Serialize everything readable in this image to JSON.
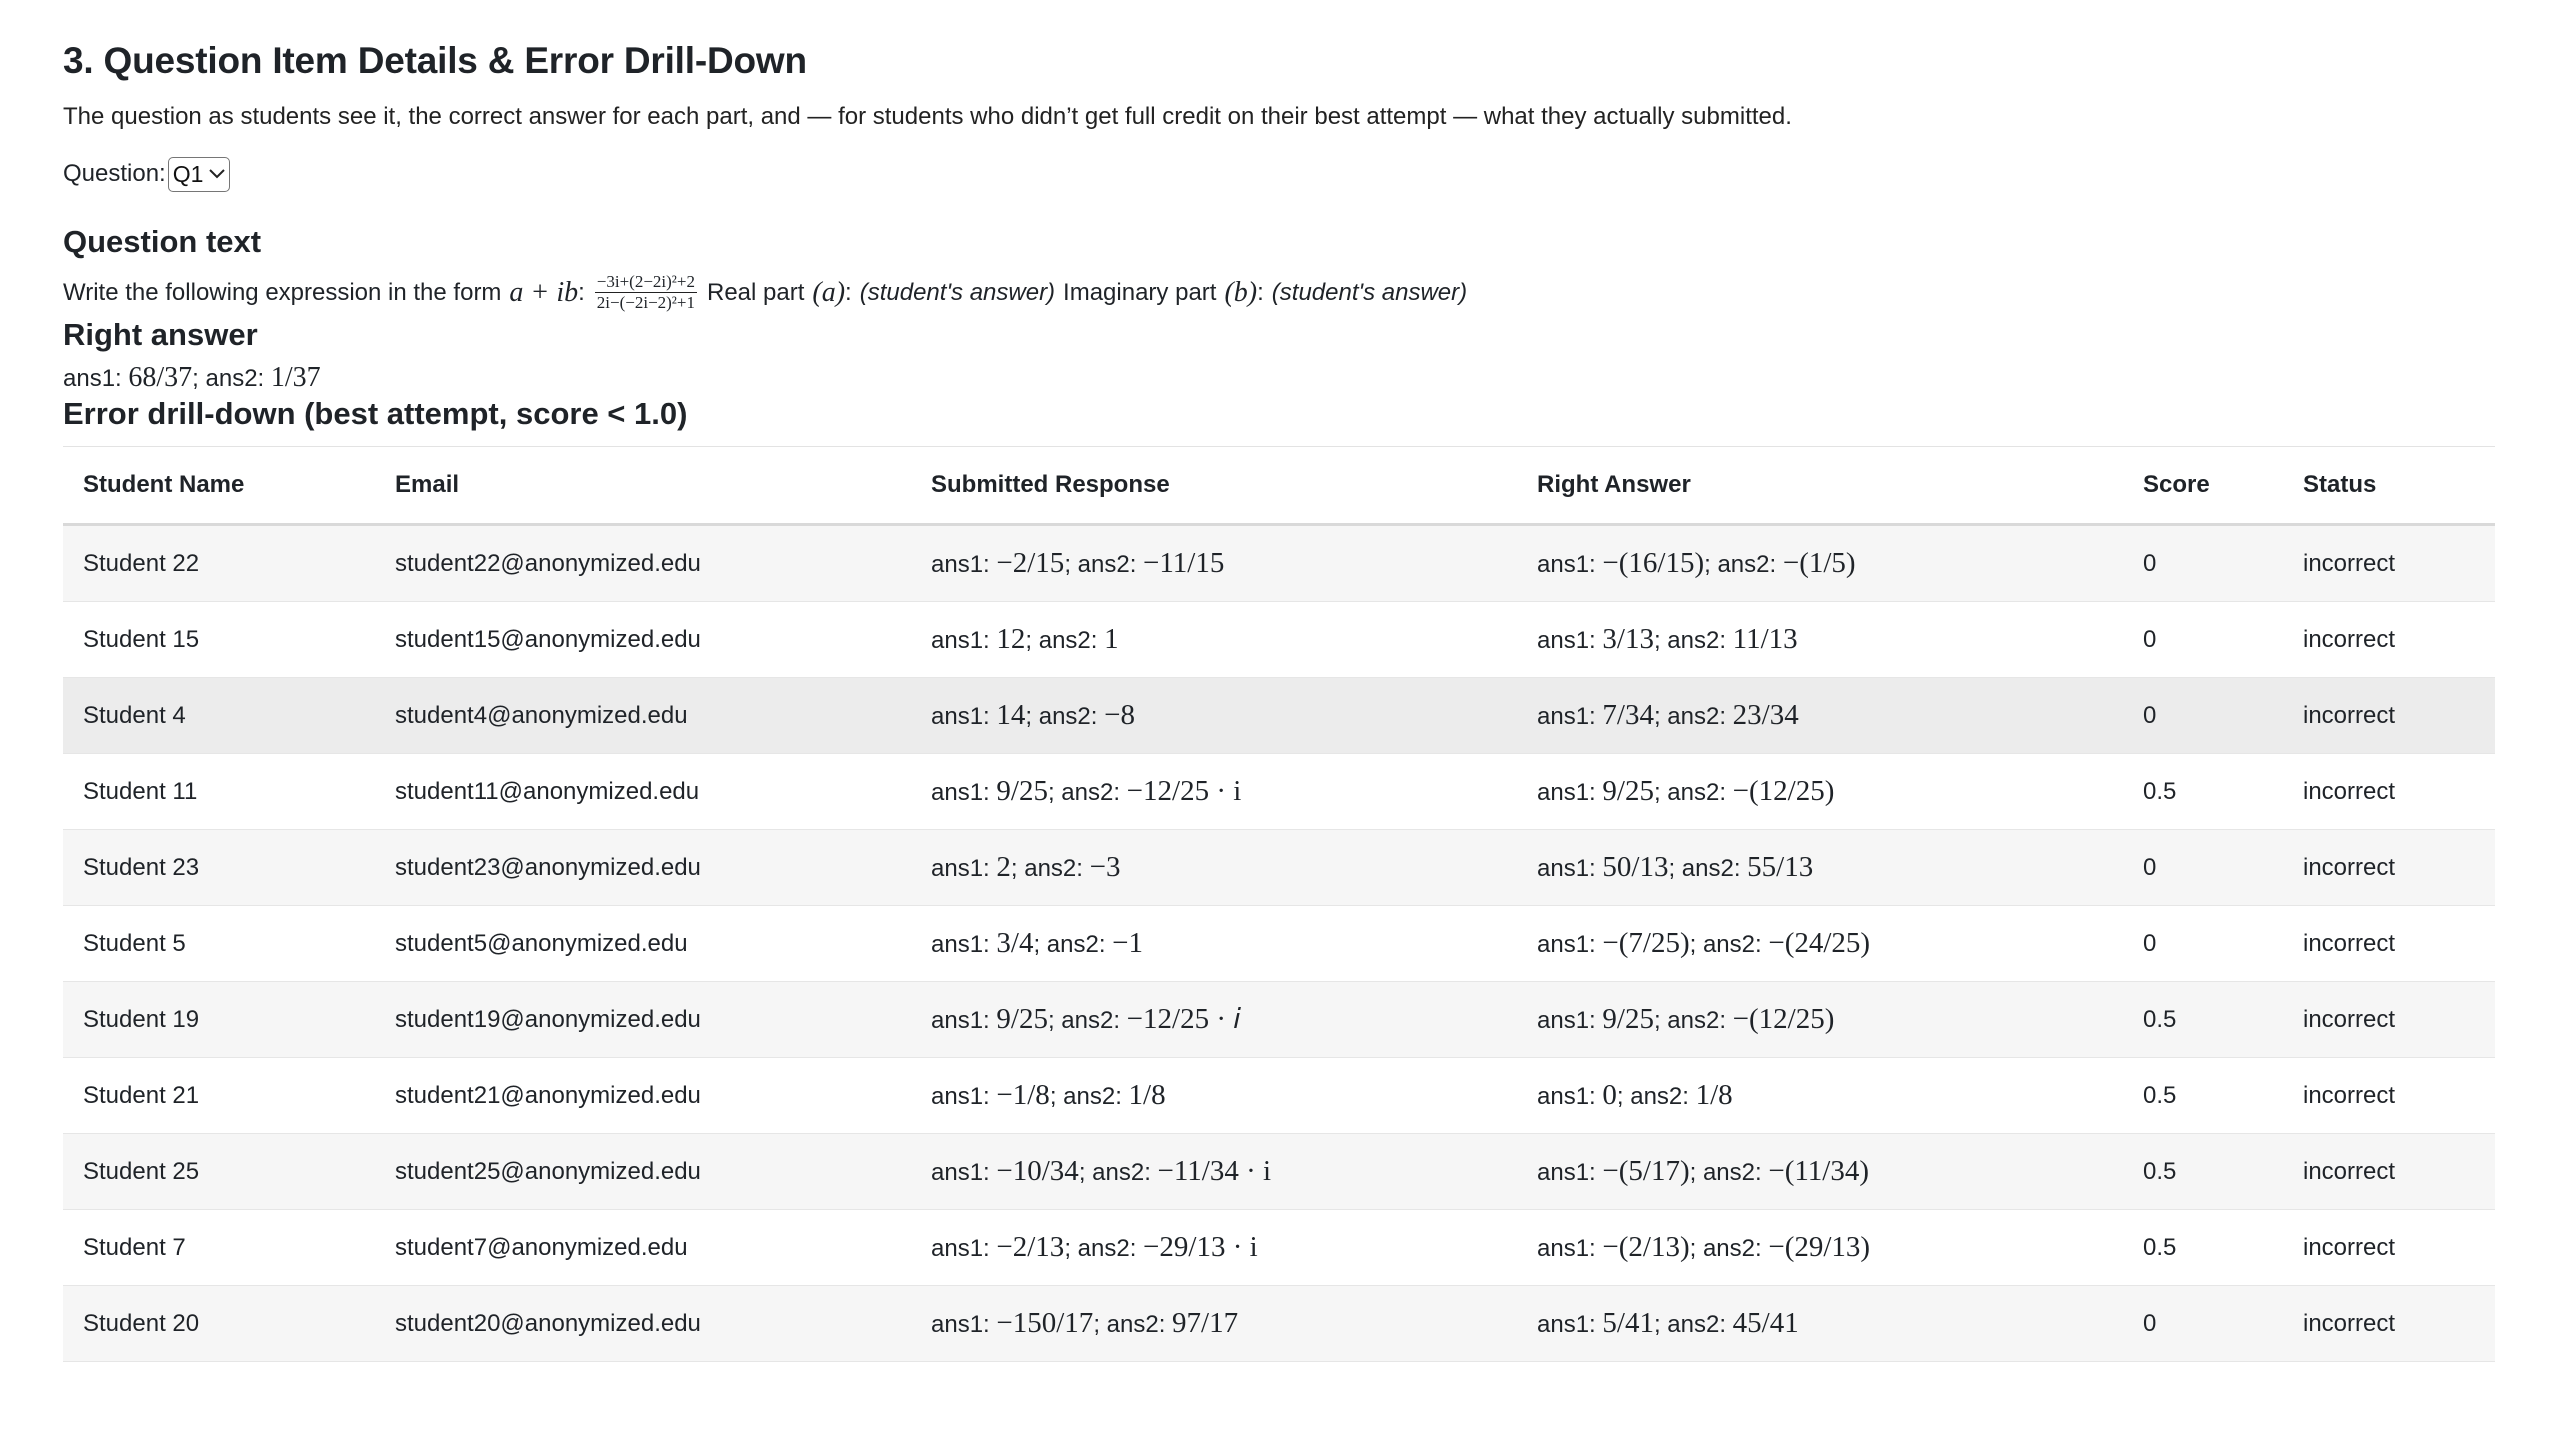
{
  "heading": "3. Question Item Details & Error Drill-Down",
  "description": "The question as students see it, the correct answer for each part, and — for students who didn’t get full credit on their best attempt — what they actually submitted.",
  "question_selector": {
    "label": "Question:",
    "value": "Q1"
  },
  "question_text": {
    "heading": "Question text",
    "prefix": "Write the following expression in the form",
    "form": "a + ib",
    "colon": ":",
    "fraction_numerator": "−3i+(2−2i)²+2",
    "fraction_denominator": "2i−(−2i−2)²+1",
    "real_label": "Real part",
    "real_var": "(a)",
    "imag_label": "Imaginary part",
    "imag_var": "(b)",
    "placeholder": "(student's answer)"
  },
  "right_answer": {
    "heading": "Right answer",
    "ans1_label": "ans1:",
    "ans1": "68/37",
    "ans2_label": "; ans2:",
    "ans2": "1/37"
  },
  "drilldown": {
    "heading": "Error drill-down (best attempt, score < 1.0)",
    "columns": [
      "Student Name",
      "Email",
      "Submitted Response",
      "Right Answer",
      "Score",
      "Status"
    ],
    "rows": [
      {
        "name": "Student 22",
        "email": "student22@anonymized.edu",
        "sub1": "−2/15",
        "sub2": "−11/15",
        "ra1": "−(16/15)",
        "ra2": "−(1/5)",
        "score": "0",
        "status": "incorrect"
      },
      {
        "name": "Student 15",
        "email": "student15@anonymized.edu",
        "sub1": "12",
        "sub2": "1",
        "ra1": "3/13",
        "ra2": "11/13",
        "score": "0",
        "status": "incorrect"
      },
      {
        "name": "Student 4",
        "email": "student4@anonymized.edu",
        "sub1": "14",
        "sub2": "−8",
        "ra1": "7/34",
        "ra2": "23/34",
        "score": "0",
        "status": "incorrect"
      },
      {
        "name": "Student 11",
        "email": "student11@anonymized.edu",
        "sub1": "9/25",
        "sub2": "−12/25 · i",
        "ra1": "9/25",
        "ra2": "−(12/25)",
        "score": "0.5",
        "status": "incorrect"
      },
      {
        "name": "Student 23",
        "email": "student23@anonymized.edu",
        "sub1": "2",
        "sub2": "−3",
        "ra1": "50/13",
        "ra2": "55/13",
        "score": "0",
        "status": "incorrect"
      },
      {
        "name": "Student 5",
        "email": "student5@anonymized.edu",
        "sub1": "3/4",
        "sub2": "−1",
        "ra1": "−(7/25)",
        "ra2": "−(24/25)",
        "score": "0",
        "status": "incorrect"
      },
      {
        "name": "Student 19",
        "email": "student19@anonymized.edu",
        "sub1": "9/25",
        "sub2": "−12/25 · 𝑖",
        "ra1": "9/25",
        "ra2": "−(12/25)",
        "score": "0.5",
        "status": "incorrect"
      },
      {
        "name": "Student 21",
        "email": "student21@anonymized.edu",
        "sub1": "−1/8",
        "sub2": "1/8",
        "ra1": "0",
        "ra2": "1/8",
        "score": "0.5",
        "status": "incorrect"
      },
      {
        "name": "Student 25",
        "email": "student25@anonymized.edu",
        "sub1": "−10/34",
        "sub2": "−11/34 · i",
        "ra1": "−(5/17)",
        "ra2": "−(11/34)",
        "score": "0.5",
        "status": "incorrect"
      },
      {
        "name": "Student 7",
        "email": "student7@anonymized.edu",
        "sub1": "−2/13",
        "sub2": "−29/13 · i",
        "ra1": "−(2/13)",
        "ra2": "−(29/13)",
        "score": "0.5",
        "status": "incorrect"
      },
      {
        "name": "Student 20",
        "email": "student20@anonymized.edu",
        "sub1": "−150/17",
        "sub2": "97/17",
        "ra1": "5/41",
        "ra2": "45/41",
        "score": "0",
        "status": "incorrect"
      }
    ]
  }
}
